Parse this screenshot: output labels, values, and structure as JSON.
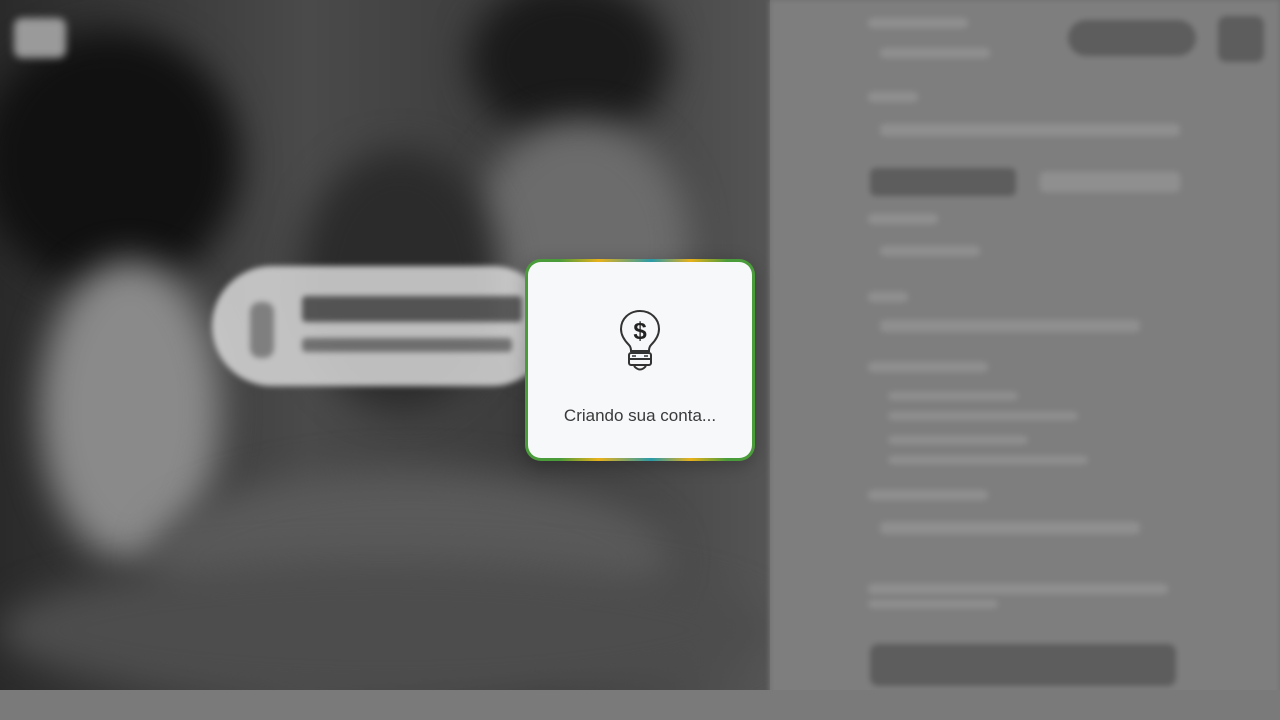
{
  "modal": {
    "message": "Criando sua conta...",
    "icon": "lightbulb-dollar-icon"
  },
  "colors": {
    "border_green": "#4a9c3a",
    "border_yellow": "#e8b11a",
    "border_teal": "#2a9aa8",
    "modal_bg": "#f7f8fa"
  }
}
